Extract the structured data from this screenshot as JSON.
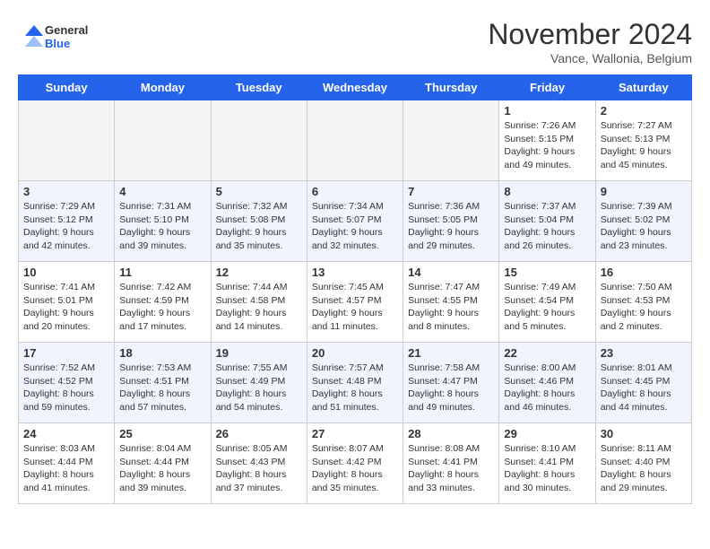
{
  "header": {
    "logo_general": "General",
    "logo_blue": "Blue",
    "month": "November 2024",
    "location": "Vance, Wallonia, Belgium"
  },
  "days_of_week": [
    "Sunday",
    "Monday",
    "Tuesday",
    "Wednesday",
    "Thursday",
    "Friday",
    "Saturday"
  ],
  "weeks": [
    {
      "shade": false,
      "days": [
        {
          "num": "",
          "info": ""
        },
        {
          "num": "",
          "info": ""
        },
        {
          "num": "",
          "info": ""
        },
        {
          "num": "",
          "info": ""
        },
        {
          "num": "",
          "info": ""
        },
        {
          "num": "1",
          "info": "Sunrise: 7:26 AM\nSunset: 5:15 PM\nDaylight: 9 hours\nand 49 minutes."
        },
        {
          "num": "2",
          "info": "Sunrise: 7:27 AM\nSunset: 5:13 PM\nDaylight: 9 hours\nand 45 minutes."
        }
      ]
    },
    {
      "shade": true,
      "days": [
        {
          "num": "3",
          "info": "Sunrise: 7:29 AM\nSunset: 5:12 PM\nDaylight: 9 hours\nand 42 minutes."
        },
        {
          "num": "4",
          "info": "Sunrise: 7:31 AM\nSunset: 5:10 PM\nDaylight: 9 hours\nand 39 minutes."
        },
        {
          "num": "5",
          "info": "Sunrise: 7:32 AM\nSunset: 5:08 PM\nDaylight: 9 hours\nand 35 minutes."
        },
        {
          "num": "6",
          "info": "Sunrise: 7:34 AM\nSunset: 5:07 PM\nDaylight: 9 hours\nand 32 minutes."
        },
        {
          "num": "7",
          "info": "Sunrise: 7:36 AM\nSunset: 5:05 PM\nDaylight: 9 hours\nand 29 minutes."
        },
        {
          "num": "8",
          "info": "Sunrise: 7:37 AM\nSunset: 5:04 PM\nDaylight: 9 hours\nand 26 minutes."
        },
        {
          "num": "9",
          "info": "Sunrise: 7:39 AM\nSunset: 5:02 PM\nDaylight: 9 hours\nand 23 minutes."
        }
      ]
    },
    {
      "shade": false,
      "days": [
        {
          "num": "10",
          "info": "Sunrise: 7:41 AM\nSunset: 5:01 PM\nDaylight: 9 hours\nand 20 minutes."
        },
        {
          "num": "11",
          "info": "Sunrise: 7:42 AM\nSunset: 4:59 PM\nDaylight: 9 hours\nand 17 minutes."
        },
        {
          "num": "12",
          "info": "Sunrise: 7:44 AM\nSunset: 4:58 PM\nDaylight: 9 hours\nand 14 minutes."
        },
        {
          "num": "13",
          "info": "Sunrise: 7:45 AM\nSunset: 4:57 PM\nDaylight: 9 hours\nand 11 minutes."
        },
        {
          "num": "14",
          "info": "Sunrise: 7:47 AM\nSunset: 4:55 PM\nDaylight: 9 hours\nand 8 minutes."
        },
        {
          "num": "15",
          "info": "Sunrise: 7:49 AM\nSunset: 4:54 PM\nDaylight: 9 hours\nand 5 minutes."
        },
        {
          "num": "16",
          "info": "Sunrise: 7:50 AM\nSunset: 4:53 PM\nDaylight: 9 hours\nand 2 minutes."
        }
      ]
    },
    {
      "shade": true,
      "days": [
        {
          "num": "17",
          "info": "Sunrise: 7:52 AM\nSunset: 4:52 PM\nDaylight: 8 hours\nand 59 minutes."
        },
        {
          "num": "18",
          "info": "Sunrise: 7:53 AM\nSunset: 4:51 PM\nDaylight: 8 hours\nand 57 minutes."
        },
        {
          "num": "19",
          "info": "Sunrise: 7:55 AM\nSunset: 4:49 PM\nDaylight: 8 hours\nand 54 minutes."
        },
        {
          "num": "20",
          "info": "Sunrise: 7:57 AM\nSunset: 4:48 PM\nDaylight: 8 hours\nand 51 minutes."
        },
        {
          "num": "21",
          "info": "Sunrise: 7:58 AM\nSunset: 4:47 PM\nDaylight: 8 hours\nand 49 minutes."
        },
        {
          "num": "22",
          "info": "Sunrise: 8:00 AM\nSunset: 4:46 PM\nDaylight: 8 hours\nand 46 minutes."
        },
        {
          "num": "23",
          "info": "Sunrise: 8:01 AM\nSunset: 4:45 PM\nDaylight: 8 hours\nand 44 minutes."
        }
      ]
    },
    {
      "shade": false,
      "days": [
        {
          "num": "24",
          "info": "Sunrise: 8:03 AM\nSunset: 4:44 PM\nDaylight: 8 hours\nand 41 minutes."
        },
        {
          "num": "25",
          "info": "Sunrise: 8:04 AM\nSunset: 4:44 PM\nDaylight: 8 hours\nand 39 minutes."
        },
        {
          "num": "26",
          "info": "Sunrise: 8:05 AM\nSunset: 4:43 PM\nDaylight: 8 hours\nand 37 minutes."
        },
        {
          "num": "27",
          "info": "Sunrise: 8:07 AM\nSunset: 4:42 PM\nDaylight: 8 hours\nand 35 minutes."
        },
        {
          "num": "28",
          "info": "Sunrise: 8:08 AM\nSunset: 4:41 PM\nDaylight: 8 hours\nand 33 minutes."
        },
        {
          "num": "29",
          "info": "Sunrise: 8:10 AM\nSunset: 4:41 PM\nDaylight: 8 hours\nand 30 minutes."
        },
        {
          "num": "30",
          "info": "Sunrise: 8:11 AM\nSunset: 4:40 PM\nDaylight: 8 hours\nand 29 minutes."
        }
      ]
    }
  ]
}
